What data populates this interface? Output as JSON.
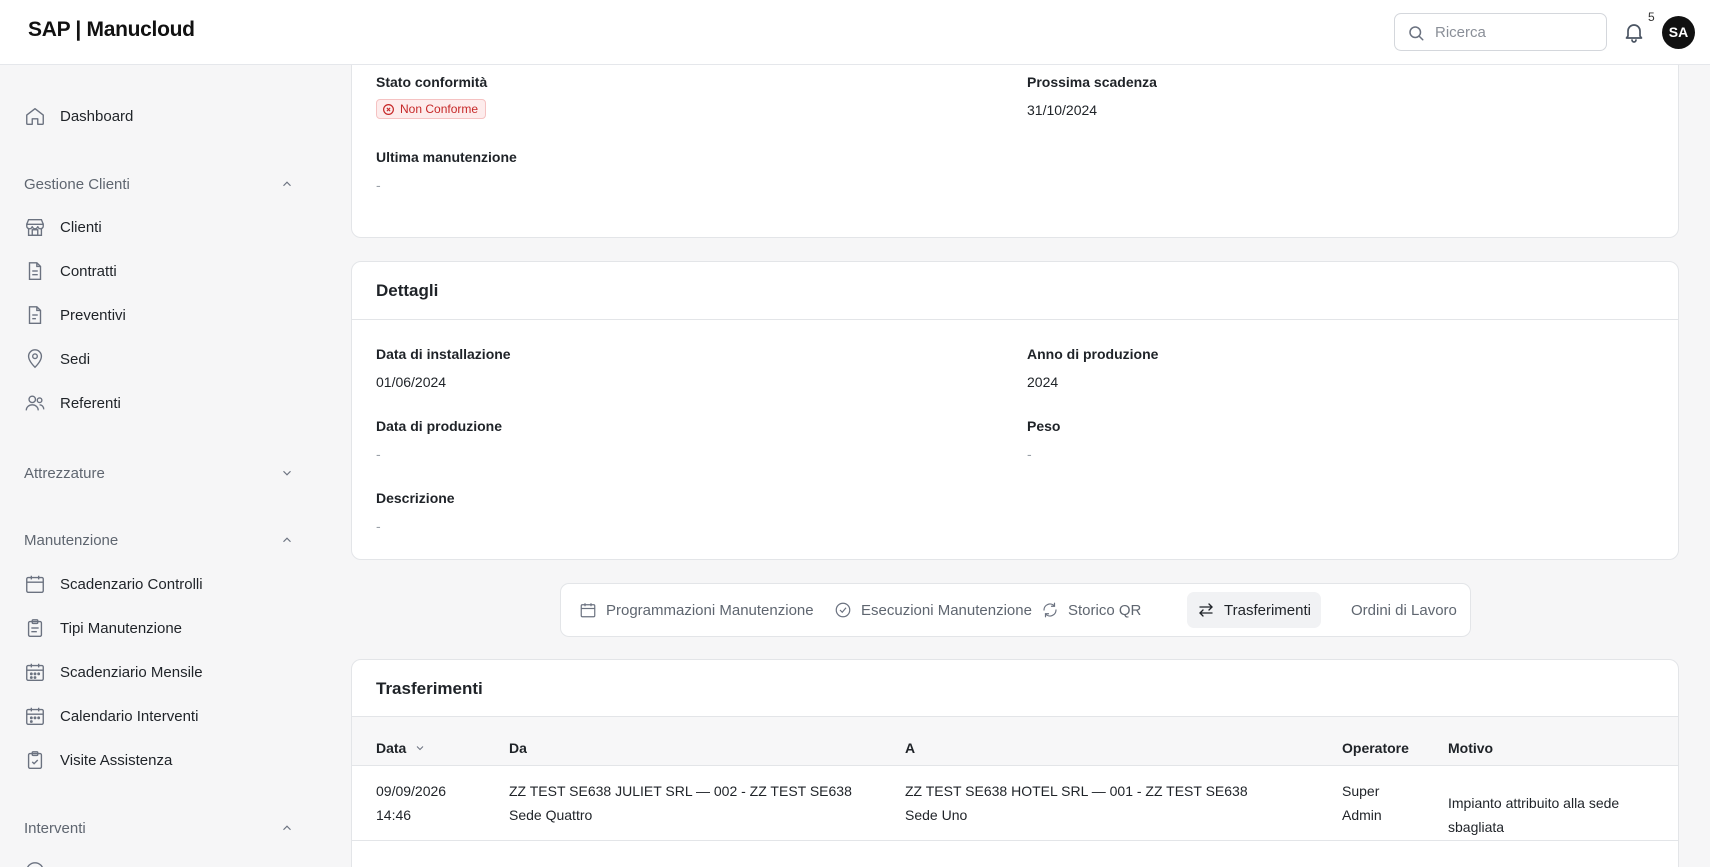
{
  "header": {
    "brand": "SAP | Manucloud",
    "search_placeholder": "Ricerca",
    "notifications_count": "5",
    "avatar_initials": "SA"
  },
  "sidebar": {
    "dashboard": "Dashboard",
    "gestione_clienti": {
      "title": "Gestione Clienti",
      "items": [
        "Clienti",
        "Contratti",
        "Preventivi",
        "Sedi",
        "Referenti"
      ]
    },
    "attrezzature": {
      "title": "Attrezzature"
    },
    "manutenzione": {
      "title": "Manutenzione",
      "items": [
        "Scadenzario Controlli",
        "Tipi Manutenzione",
        "Scadenziario Mensile",
        "Calendario Interventi",
        "Visite Assistenza"
      ]
    },
    "interventi": {
      "title": "Interventi"
    }
  },
  "status_card": {
    "stato_label": "Stato conformità",
    "stato_badge": "Non Conforme",
    "scadenza_label": "Prossima scadenza",
    "scadenza_value": "31/10/2024",
    "manutenzione_label": "Ultima manutenzione",
    "manutenzione_value": "-"
  },
  "dettagli": {
    "title": "Dettagli",
    "installazione_label": "Data di installazione",
    "installazione_value": "01/06/2024",
    "anno_label": "Anno di produzione",
    "anno_value": "2024",
    "data_prod_label": "Data di produzione",
    "data_prod_value": "-",
    "peso_label": "Peso",
    "peso_value": "-",
    "descrizione_label": "Descrizione",
    "descrizione_value": "-"
  },
  "tabs": [
    "Programmazioni Manutenzione",
    "Esecuzioni Manutenzione",
    "Storico QR",
    "Trasferimenti",
    "Ordini di Lavoro"
  ],
  "trasferimenti": {
    "title": "Trasferimenti",
    "columns": [
      "Data",
      "Da",
      "A",
      "Operatore",
      "Motivo"
    ],
    "rows": [
      {
        "data_line1": "09/09/2026",
        "data_line2": "14:46",
        "da_line1": "ZZ TEST SE638 JULIET SRL — 002 - ZZ TEST SE638",
        "da_line2": "Sede Quattro",
        "a_line1": "ZZ TEST SE638 HOTEL SRL — 001 - ZZ TEST SE638",
        "a_line2": "Sede Uno",
        "operatore_line1": "Super",
        "operatore_line2": "Admin",
        "motivo": "Impianto attribuito alla sede sbagliata"
      }
    ]
  }
}
